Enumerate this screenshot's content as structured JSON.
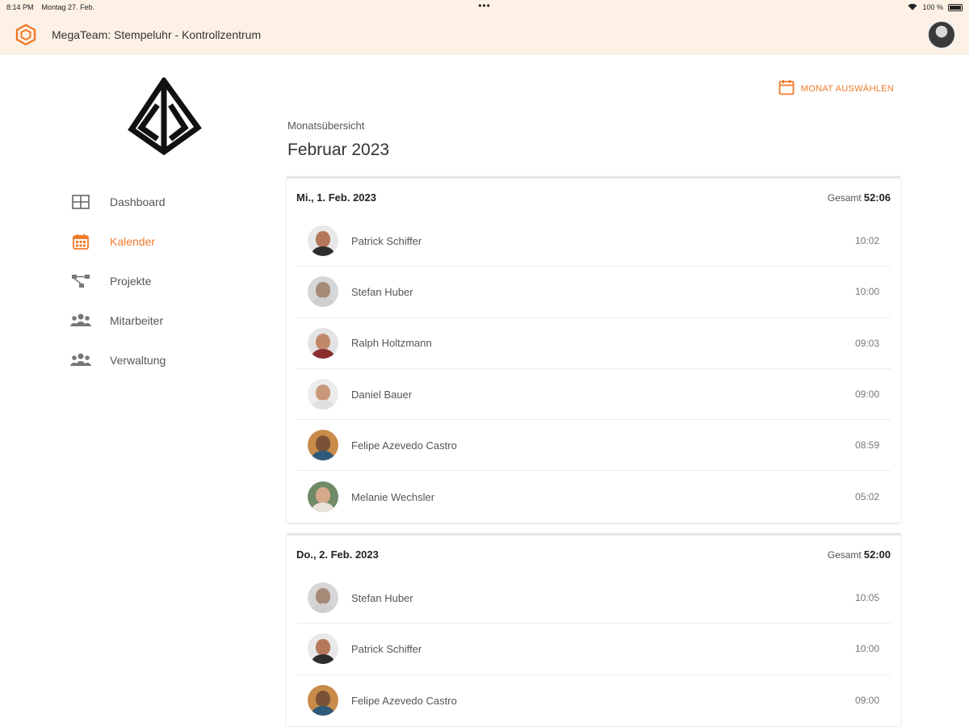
{
  "statusbar": {
    "time": "8:14 PM",
    "date": "Montag 27. Feb.",
    "battery": "100 %"
  },
  "appbar": {
    "title": "MegaTeam: Stempeluhr - Kontrollzentrum"
  },
  "colors": {
    "accent": "#f07a2a",
    "header_bg": "#fdf1e6"
  },
  "sidebar": {
    "items": [
      {
        "label": "Dashboard",
        "icon": "dashboard-grid-icon",
        "active": false
      },
      {
        "label": "Kalender",
        "icon": "calendar-icon",
        "active": true
      },
      {
        "label": "Projekte",
        "icon": "project-network-icon",
        "active": false
      },
      {
        "label": "Mitarbeiter",
        "icon": "people-group-icon",
        "active": false
      },
      {
        "label": "Verwaltung",
        "icon": "people-group-icon",
        "active": false
      }
    ]
  },
  "main": {
    "pick_month_label": "MONAT AUSWÄHLEN",
    "overview_label": "Monatsübersicht",
    "month_title": "Februar 2023",
    "total_label": "Gesamt",
    "days": [
      {
        "title": "Mi., 1. Feb. 2023",
        "total": "52:06",
        "entries": [
          {
            "name": "Patrick Schiffer",
            "time": "10:02"
          },
          {
            "name": "Stefan Huber",
            "time": "10:00"
          },
          {
            "name": "Ralph Holtzmann",
            "time": "09:03"
          },
          {
            "name": "Daniel Bauer",
            "time": "09:00"
          },
          {
            "name": "Felipe Azevedo  Castro",
            "time": "08:59"
          },
          {
            "name": "Melanie Wechsler",
            "time": "05:02"
          }
        ]
      },
      {
        "title": "Do., 2. Feb. 2023",
        "total": "52:00",
        "entries": [
          {
            "name": "Stefan Huber",
            "time": "10:05"
          },
          {
            "name": "Patrick Schiffer",
            "time": "10:00"
          },
          {
            "name": "Felipe Azevedo  Castro",
            "time": "09:00"
          }
        ]
      }
    ]
  }
}
